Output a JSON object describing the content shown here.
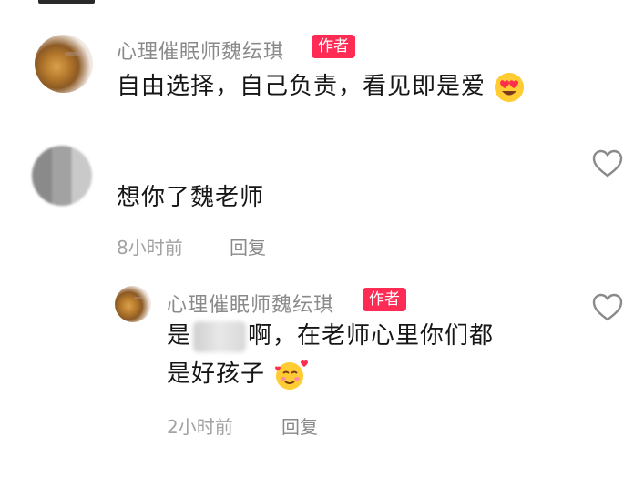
{
  "comments": [
    {
      "username": "心理催眠师魏纭琪",
      "badge": "作者",
      "text": "自由选择，自己负责，看见即是爱",
      "emoji": "heart-eyes-emoji"
    },
    {
      "username": "",
      "text": "想你了魏老师",
      "time": "8小时前",
      "reply_label": "回复",
      "reply": {
        "username": "心理催眠师魏纭琪",
        "badge": "作者",
        "line1_start": "是",
        "line1_end": "啊，在老师心里你们都",
        "line2": "是好孩子",
        "emoji": "smiling-hearts-emoji",
        "time": "2小时前",
        "reply_label": "回复"
      }
    }
  ],
  "colors": {
    "badge": "#fe2c55",
    "meta": "#a2a2a2",
    "username": "#8a8a8a"
  }
}
